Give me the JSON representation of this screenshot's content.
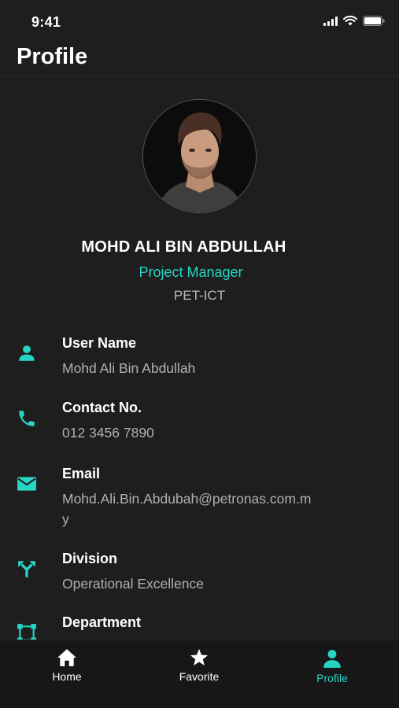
{
  "status_bar": {
    "time": "9:41"
  },
  "header": {
    "title": "Profile"
  },
  "profile": {
    "name": "MOHD ALI BIN ABDULLAH",
    "role": "Project Manager",
    "organization": "PET-ICT"
  },
  "details": [
    {
      "icon": "person-icon",
      "label": "User Name",
      "value": "Mohd Ali Bin Abdullah"
    },
    {
      "icon": "phone-icon",
      "label": "Contact No.",
      "value": "012 3456 7890"
    },
    {
      "icon": "mail-icon",
      "label": "Email",
      "value": "Mohd.Ali.Bin.Abdubah@petronas.com.my"
    },
    {
      "icon": "merge-arrows-icon",
      "label": "Division",
      "value": "Operational Excellence"
    },
    {
      "icon": "network-icon",
      "label": "Department",
      "value": ""
    }
  ],
  "tabs": [
    {
      "icon": "home-icon",
      "label": "Home",
      "active": false
    },
    {
      "icon": "star-icon",
      "label": "Favorite",
      "active": false
    },
    {
      "icon": "person-icon",
      "label": "Profile",
      "active": true
    }
  ],
  "colors": {
    "accent": "#25d6c4",
    "background": "#1e1e1e",
    "tab_bar": "#171717"
  }
}
